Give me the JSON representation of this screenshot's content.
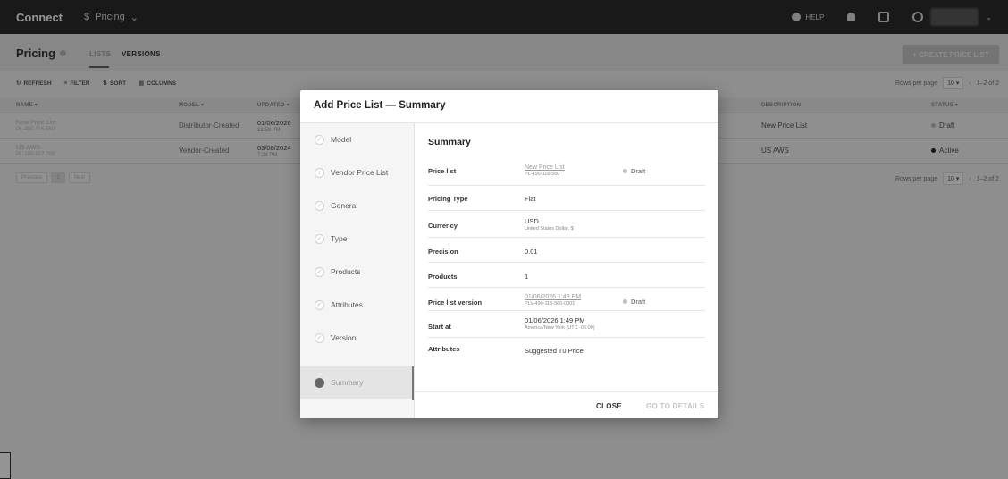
{
  "appbar": {
    "brand": "Connect",
    "module_icon": "$",
    "module": "Pricing",
    "help": "HELP"
  },
  "subheader": {
    "title": "Pricing",
    "tabs": [
      "LISTS",
      "VERSIONS"
    ],
    "create_button": "+ CREATE PRICE LIST"
  },
  "toolbar": {
    "refresh": "REFRESH",
    "filter": "FILTER",
    "sort": "SORT",
    "columns": "COLUMNS",
    "rows_per_page_label": "Rows per page",
    "rows_per_page_value": "10 ▾",
    "range": "1–2 of 2"
  },
  "table": {
    "headers": [
      "NAME ▾",
      "MODEL ▾",
      "UPDATED ▾",
      "DESCRIPTION",
      "STATUS ▾"
    ],
    "rows": [
      {
        "name": "New Price List",
        "id": "PL-490-116-560",
        "model": "Distributor-Created",
        "updated_date": "01/06/2026",
        "updated_time": "12:50 PM",
        "description": "New Price List",
        "status": "Draft",
        "status_color": "#bdbdbd"
      },
      {
        "name": "US AWS",
        "id": "PL-180-827-709",
        "model": "Vendor-Created",
        "updated_date": "03/08/2024",
        "updated_time": "7:23 PM",
        "description": "US AWS",
        "status": "Active",
        "status_color": "#222222"
      }
    ]
  },
  "pager": {
    "prev": "Previous",
    "page": "1",
    "next": "Next"
  },
  "dialog": {
    "title": "Add Price List — Summary",
    "steps": [
      "Model",
      "Vendor Price List",
      "General",
      "Type",
      "Products",
      "Attributes",
      "Version",
      "Summary"
    ],
    "summary_title": "Summary",
    "rows": {
      "price_list_label": "Price list",
      "price_list_name": "New Price List",
      "price_list_id": "PL-490-116-560",
      "price_list_status": "Draft",
      "pricing_type_label": "Pricing Type",
      "pricing_type": "Flat",
      "currency_label": "Currency",
      "currency": "USD",
      "currency_sub": "United States Dollar, $",
      "precision_label": "Precision",
      "precision": "0.01",
      "products_label": "Products",
      "products": "1",
      "version_label": "Price list version",
      "version_name": "01/06/2026 1:49 PM",
      "version_id": "PLV-490-116-560-0001",
      "version_status": "Draft",
      "start_label": "Start at",
      "start": "01/06/2026 1:49 PM",
      "start_tz": "America/New York (UTC -05:00)",
      "attributes_label": "Attributes",
      "attributes": "Suggested T0 Price"
    },
    "close": "CLOSE",
    "go_to_details": "GO TO DETAILS"
  }
}
